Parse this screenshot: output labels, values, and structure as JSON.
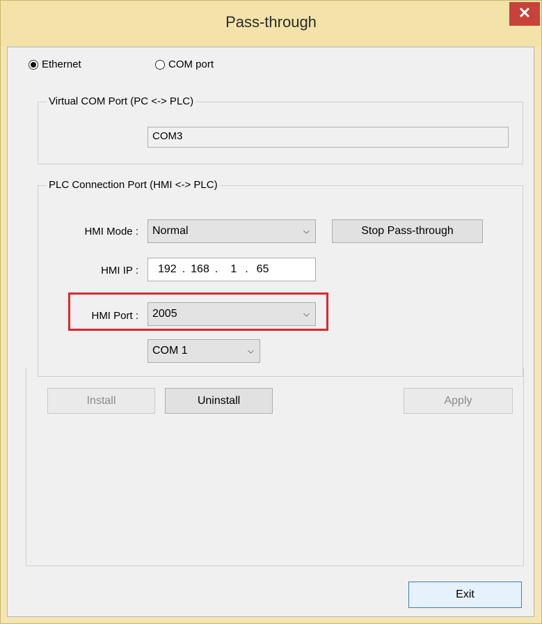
{
  "window": {
    "title": "Pass-through",
    "close_glyph": "✕"
  },
  "connection": {
    "ethernet_label": "Ethernet",
    "com_label": "COM port",
    "selected": "Ethernet"
  },
  "virtual_com": {
    "group_label": "Virtual COM Port (PC <-> PLC)",
    "value": "COM3"
  },
  "plc_port": {
    "group_label": "PLC Connection Port (HMI <-> PLC)",
    "hmi_mode_label": "HMI Mode :",
    "hmi_mode_value": "Normal",
    "stop_button": "Stop Pass-through",
    "hmi_ip_label": "HMI IP :",
    "ip": [
      "192",
      "168",
      "1",
      "65"
    ],
    "ip_dot": ".",
    "hmi_port_label": "HMI Port :",
    "hmi_port_value": "2005",
    "com_select_value": "COM 1",
    "highlight_color": "#e0262e"
  },
  "actions": {
    "install": "Install",
    "uninstall": "Uninstall",
    "apply": "Apply",
    "exit": "Exit"
  },
  "icons": {
    "dropdown": "chevron-down-icon",
    "close": "close-icon"
  }
}
